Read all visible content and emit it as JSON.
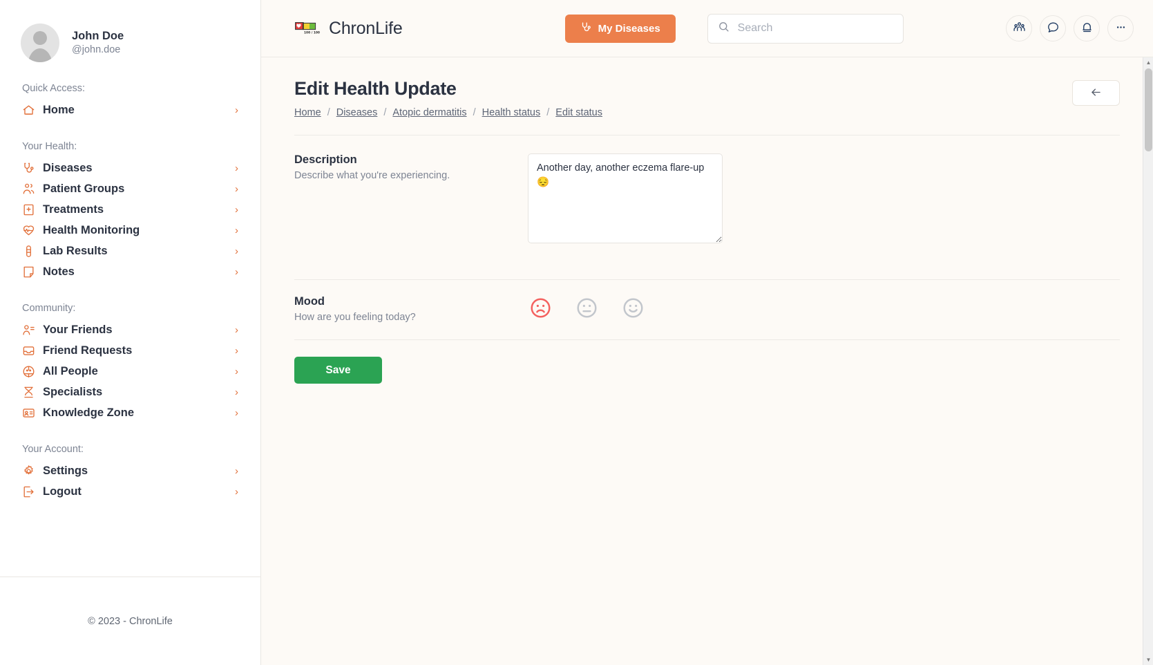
{
  "sidebar": {
    "profile": {
      "name": "John Doe",
      "handle": "@john.doe"
    },
    "groups": [
      {
        "title": "Quick Access:",
        "items": [
          {
            "label": "Home",
            "icon": "home-icon"
          }
        ]
      },
      {
        "title": "Your Health:",
        "items": [
          {
            "label": "Diseases",
            "icon": "stethoscope-icon"
          },
          {
            "label": "Patient Groups",
            "icon": "people-group-icon"
          },
          {
            "label": "Treatments",
            "icon": "hospital-icon"
          },
          {
            "label": "Health Monitoring",
            "icon": "heart-pulse-icon"
          },
          {
            "label": "Lab Results",
            "icon": "test-tube-icon"
          },
          {
            "label": "Notes",
            "icon": "note-icon"
          }
        ]
      },
      {
        "title": "Community:",
        "items": [
          {
            "label": "Your Friends",
            "icon": "user-list-icon"
          },
          {
            "label": "Friend Requests",
            "icon": "inbox-icon"
          },
          {
            "label": "All People",
            "icon": "globe-people-icon"
          },
          {
            "label": "Specialists",
            "icon": "doctor-icon"
          },
          {
            "label": "Knowledge Zone",
            "icon": "id-card-icon"
          }
        ]
      },
      {
        "title": "Your Account:",
        "items": [
          {
            "label": "Settings",
            "icon": "gear-icon"
          },
          {
            "label": "Logout",
            "icon": "logout-icon"
          }
        ]
      }
    ],
    "chevron": "›",
    "footer": "© 2023 - ChronLife"
  },
  "header": {
    "brand_name": "ChronLife",
    "logo_caption": "100 / 100",
    "my_diseases_label": "My Diseases",
    "search_placeholder": "Search",
    "search_value": "",
    "icons": [
      {
        "name": "people-group-icon"
      },
      {
        "name": "chat-bubble-icon"
      },
      {
        "name": "bell-icon"
      },
      {
        "name": "ellipsis-icon"
      }
    ]
  },
  "page": {
    "title": "Edit Health Update",
    "breadcrumb": [
      "Home",
      "Diseases",
      "Atopic dermatitis",
      "Health status",
      "Edit status"
    ],
    "breadcrumb_separator": "/",
    "back_button": "back-arrow-icon"
  },
  "form": {
    "description": {
      "label": "Description",
      "hint": "Describe what you're experiencing.",
      "value": "Another day, another eczema flare-up 😔",
      "placeholder": ""
    },
    "mood": {
      "label": "Mood",
      "hint": "How are you feeling today?",
      "selected": "sad",
      "selected_color": "#f4615f",
      "unselected_color": "#c2c6cc",
      "options": [
        {
          "value": "sad",
          "icon": "sad-face-icon"
        },
        {
          "value": "neutral",
          "icon": "neutral-face-icon"
        },
        {
          "value": "happy",
          "icon": "happy-face-icon"
        }
      ]
    },
    "save_label": "Save"
  },
  "colors": {
    "accent_orange": "#ec7f4b",
    "sidebar_icon": "#e2703a",
    "save_green": "#2ba353",
    "mood_selected": "#f4615f",
    "page_bg": "#fdfaf6"
  }
}
